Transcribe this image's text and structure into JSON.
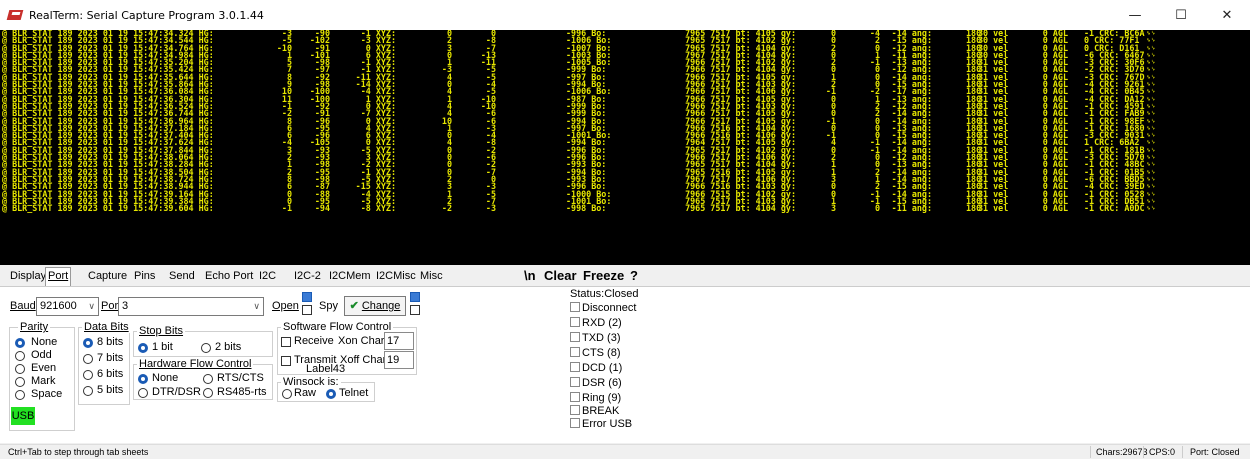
{
  "window": {
    "title": "RealTerm: Serial Capture Program 3.0.1.44",
    "minimize": "—",
    "maximize": "☐",
    "close": "✕"
  },
  "terminal": {
    "text_color": "#e6e600",
    "background": "#000000",
    "rows": [
      [
        "@ BLR_STAT 189 2023 01 19 15:47:34.324 HG:",
        "-3",
        "-90",
        "-1 XYZ:",
        "0",
        "0",
        "-996 Bo:",
        "7965 7517 bt: 4105 gy:",
        "0",
        "-4",
        "-14 ang:",
        "180",
        "30 vel",
        "0 AGL",
        "-1 CRC: BC6A"
      ],
      [
        "@ BLR_STAT 189 2023 01 19 15:47:34.544 HG:",
        "-5",
        "-102",
        "-3 XYZ:",
        "2",
        "-8",
        "-1006 Bo:",
        "7965 7517 bt: 4102 gy:",
        "0",
        "2",
        "-15 ang:",
        "180",
        "30 vel",
        "0 AGL",
        "0 CRC: 77F1"
      ],
      [
        "@ BLR_STAT 189 2023 01 19 15:47:34.764 HG:",
        "-10",
        "-91",
        "0 XYZ:",
        "3",
        "-7",
        "-1007 Bo:",
        "7965 7517 bt: 4104 gy:",
        "2",
        "0",
        "-12 ang:",
        "180",
        "30 vel",
        "0 AGL",
        "0 CRC: D161"
      ],
      [
        "@ BLR_STAT 189 2023 01 19 15:47:34.984 HG:",
        "1",
        "-101",
        "6 XYZ:",
        "0",
        "-13",
        "-1003 Bo:",
        "7967 7517 bt: 4104 gy:",
        "0",
        "1",
        "-11 ang:",
        "180",
        "30 vel",
        "0 AGL",
        "-6 CRC: 6467"
      ],
      [
        "@ BLR_STAT 189 2023 01 19 15:47:35.204 HG:",
        "5",
        "-98",
        "-1 XYZ:",
        "1",
        "-11",
        "-1005 Bo:",
        "7966 7517 bt: 4102 gy:",
        "2",
        "-1",
        "-13 ang:",
        "180",
        "31 vel",
        "0 AGL",
        "-3 CRC: 30F6"
      ],
      [
        "@ BLR_STAT 189 2023 01 19 15:47:35.424 HG:",
        "7",
        "-97",
        "-1 XYZ:",
        "-3",
        "-5",
        "-999 Bo:",
        "7966 7517 bt: 4104 gy:",
        "0",
        "0",
        "-12 ang:",
        "180",
        "31 vel",
        "0 AGL",
        "-2 CRC: 3D70"
      ],
      [
        "@ BLR_STAT 189 2023 01 19 15:47:35.644 HG:",
        "8",
        "-92",
        "-11 XYZ:",
        "4",
        "-5",
        "-997 Bo:",
        "7966 7517 bt: 4105 gy:",
        "1",
        "0",
        "-14 ang:",
        "180",
        "31 vel",
        "0 AGL",
        "-3 CRC: 767D"
      ],
      [
        "@ BLR_STAT 189 2023 01 19 15:47:35.864 HG:",
        "9",
        "-98",
        "-14 XYZ:",
        "0",
        "-4",
        "-994 Bo:",
        "7966 7517 bt: 4103 gy:",
        "2",
        "0",
        "-15 ang:",
        "180",
        "31 vel",
        "0 AGL",
        "-4 CRC: 9261"
      ],
      [
        "@ BLR_STAT 189 2023 01 19 15:47:36.084 HG:",
        "10",
        "-100",
        "-4 XYZ:",
        "4",
        "-5",
        "-1006 Bo:",
        "7966 7517 bt: 4106 gy:",
        "-1",
        "-2",
        "-17 ang:",
        "180",
        "31 vel",
        "0 AGL",
        "-4 CRC: 0B45"
      ],
      [
        "@ BLR_STAT 189 2023 01 19 15:47:36.304 HG:",
        "11",
        "-100",
        "1 XYZ:",
        "1",
        "-10",
        "-987 Bo:",
        "7966 7517 bt: 4105 gy:",
        "0",
        "1",
        "-13 ang:",
        "180",
        "31 vel",
        "0 AGL",
        "-4 CRC: DA12"
      ],
      [
        "@ BLR_STAT 189 2023 01 19 15:47:36.524 HG:",
        "-1",
        "-92",
        "0 XYZ:",
        "4",
        "-10",
        "-999 Bo:",
        "7966 7517 bt: 4103 gy:",
        "0",
        "2",
        "-12 ang:",
        "180",
        "31 vel",
        "0 AGL",
        "-1 CRC: 4591"
      ],
      [
        "@ BLR_STAT 189 2023 01 19 15:47:36.744 HG:",
        "-2",
        "-91",
        "-7 XYZ:",
        "4",
        "-6",
        "-999 Bo:",
        "7966 7517 bt: 4105 gy:",
        "0",
        "2",
        "-14 ang:",
        "180",
        "31 vel",
        "0 AGL",
        "-1 CRC: FAB9"
      ],
      [
        "@ BLR_STAT 189 2023 01 19 15:47:36.964 HG:",
        "8",
        "-96",
        "0 XYZ:",
        "10",
        "-6",
        "-994 Bo:",
        "7966 7517 bt: 4105 gy:",
        "-1",
        "0",
        "-14 ang:",
        "180",
        "31 vel",
        "0 AGL",
        "-1 CRC: 98EF"
      ],
      [
        "@ BLR_STAT 189 2023 01 19 15:47:37.184 HG:",
        "6",
        "-95",
        "4 XYZ:",
        "1",
        "-3",
        "-997 Bo:",
        "7966 7516 bt: 4104 gy:",
        "0",
        "0",
        "-13 ang:",
        "180",
        "31 vel",
        "0 AGL",
        "-1 CRC: 1680"
      ],
      [
        "@ BLR_STAT 189 2023 01 19 15:47:37.404 HG:",
        "6",
        "-96",
        "6 XYZ:",
        "0",
        "-4",
        "-1001 Bo:",
        "7966 7516 bt: 4106 gy:",
        "-1",
        "0",
        "-15 ang:",
        "180",
        "31 vel",
        "0 AGL",
        "-3 CRC: 9031"
      ],
      [
        "@ BLR_STAT 189 2023 01 19 15:47:37.624 HG:",
        "-4",
        "-105",
        "0 XYZ:",
        "4",
        "-8",
        "-994 Bo:",
        "7964 7517 bt: 4105 gy:",
        "4",
        "-1",
        "-14 ang:",
        "180",
        "31 vel",
        "0 AGL",
        "1 CRC: 6BA2"
      ],
      [
        "@ BLR_STAT 189 2023 01 19 15:47:37.844 HG:",
        "3",
        "-93",
        "-5 XYZ:",
        "0",
        "-2",
        "-996 Bo:",
        "7965 7517 bt: 4102 gy:",
        "0",
        "-1",
        "-14 ang:",
        "180",
        "31 vel",
        "0 AGL",
        "-1 CRC: 181B"
      ],
      [
        "@ BLR_STAT 189 2023 01 19 15:47:38.064 HG:",
        "2",
        "-93",
        "3 XYZ:",
        "0",
        "-6",
        "-996 Bo:",
        "7966 7517 bt: 4106 gy:",
        "2",
        "0",
        "-12 ang:",
        "180",
        "31 vel",
        "0 AGL",
        "-3 CRC: 5D70"
      ],
      [
        "@ BLR_STAT 189 2023 01 19 15:47:38.284 HG:",
        "1",
        "-98",
        "-2 XYZ:",
        "0",
        "-2",
        "-993 Bo:",
        "7965 7517 bt: 4104 gy:",
        "1",
        "0",
        "-13 ang:",
        "180",
        "31 vel",
        "0 AGL",
        "-1 CRC: 48BC"
      ],
      [
        "@ BLR_STAT 189 2023 01 19 15:47:38.504 HG:",
        "2",
        "-95",
        "-1 XYZ:",
        "0",
        "-7",
        "-994 Bo:",
        "7965 7516 bt: 4105 gy:",
        "1",
        "2",
        "-14 ang:",
        "180",
        "31 vel",
        "0 AGL",
        "-1 CRC: 01B5"
      ],
      [
        "@ BLR_STAT 189 2023 01 19 15:47:38.724 HG:",
        "8",
        "-98",
        "-5 XYZ:",
        "2",
        "0",
        "-993 Bo:",
        "7967 7517 bt: 4106 gy:",
        "3",
        "1",
        "-14 ang:",
        "180",
        "31 vel",
        "0 AGL",
        "-6 CRC: BBD5"
      ],
      [
        "@ BLR_STAT 189 2023 01 19 15:47:38.944 HG:",
        "6",
        "-87",
        "-15 XYZ:",
        "3",
        "-3",
        "-996 Bo:",
        "7966 7516 bt: 4103 gy:",
        "0",
        "2",
        "-15 ang:",
        "180",
        "31 vel",
        "0 AGL",
        "-4 CRC: 39ED"
      ],
      [
        "@ BLR_STAT 189 2023 01 19 15:47:39.164 HG:",
        "0",
        "-88",
        "-4 XYZ:",
        "1",
        "-5",
        "-1000 Bo:",
        "7966 7515 bt: 4102 gy:",
        "0",
        "-1",
        "-14 ang:",
        "180",
        "31 vel",
        "0 AGL",
        "-1 CRC: 0528"
      ],
      [
        "@ BLR_STAT 189 2023 01 19 15:47:39.384 HG:",
        "0",
        "-95",
        "-5 XYZ:",
        "2",
        "-7",
        "-1001 Bo:",
        "7965 7517 bt: 4103 gy:",
        "1",
        "-1",
        "-15 ang:",
        "180",
        "31 vel",
        "0 AGL",
        "-1 CRC: DB51"
      ],
      [
        "@ BLR_STAT 189 2023 01 19 15:47:39.604 HG:",
        "-1",
        "-94",
        "-8 XYZ:",
        "-2",
        "-3",
        "-998 Bo:",
        "7965 7517 bt: 4104 gy:",
        "3",
        "0",
        "-11 ang:",
        "180",
        "31 vel",
        "0 AGL",
        "-1 CRC: A0DC"
      ]
    ],
    "crlf_glyph": "␍␊"
  },
  "tabs": {
    "items": [
      "Display",
      "Port",
      "Capture",
      "Pins",
      "Send",
      "Echo Port",
      "I2C",
      "I2C-2",
      "I2CMem",
      "I2CMisc",
      "Misc"
    ],
    "active": "Port",
    "newline_button": "\\n",
    "clear_button": "Clear",
    "freeze_button": "Freeze",
    "help_button": "?"
  },
  "port": {
    "baud_label": "Baud",
    "baud_value": "921600",
    "port_label": "Port",
    "port_value": "3",
    "open_button": "Open",
    "spy_button": "Spy",
    "change_button": "Change",
    "change_check": "✔",
    "parity": {
      "label": "Parity",
      "options": [
        "None",
        "Odd",
        "Even",
        "Mark",
        "Space"
      ],
      "selected": "None"
    },
    "data_bits": {
      "label": "Data Bits",
      "options": [
        "8 bits",
        "7 bits",
        "6 bits",
        "5 bits"
      ],
      "selected": "8 bits"
    },
    "stop_bits": {
      "label": "Stop Bits",
      "options": [
        "1 bit",
        "2 bits"
      ],
      "selected": "1 bit"
    },
    "hardware_flow": {
      "label": "Hardware Flow Control",
      "options": [
        "None",
        "RTS/CTS",
        "DTR/DSR",
        "RS485-rts"
      ],
      "selected": "None"
    },
    "software_flow": {
      "label": "Software Flow Control",
      "receive_label": "Receive",
      "transmit_label": "Transmit",
      "xon_label": "Xon Char:",
      "xon_value": "17",
      "xoff_label": "Xoff Char:",
      "xoff_value": "19",
      "label43": "Label43"
    },
    "winsock": {
      "label": "Winsock is:",
      "options": [
        "Raw",
        "Telnet"
      ],
      "selected": "Telnet"
    },
    "usb_indicator": "USB",
    "usb_color": "#22e022"
  },
  "status_panel": {
    "title": "Status:Closed",
    "items": [
      "Disconnect",
      "RXD (2)",
      "TXD (3)",
      "CTS (8)",
      "DCD (1)",
      "DSR (6)",
      "Ring (9)",
      "BREAK",
      "Error"
    ],
    "usb_label": "USB"
  },
  "statusbar": {
    "hint": "Ctrl+Tab to step through tab sheets",
    "chars": "Chars:29673",
    "cps": "CPS:0",
    "port_status": "Port: Closed"
  }
}
